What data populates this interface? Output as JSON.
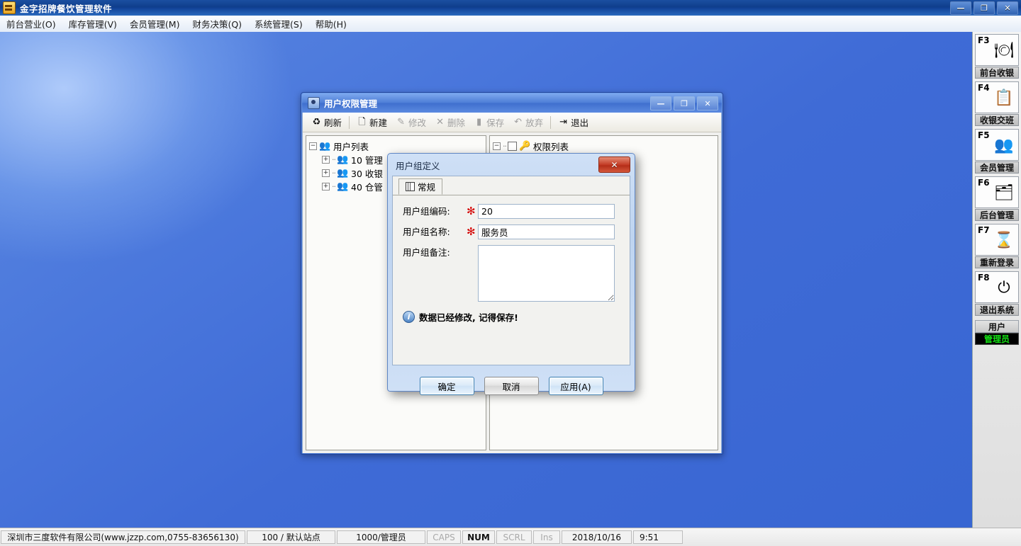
{
  "window": {
    "title": "金字招牌餐饮管理软件",
    "icon": "app-icon",
    "controls": {
      "minimize": "—",
      "restore": "❐",
      "close": "✕"
    }
  },
  "menubar": {
    "items": [
      {
        "label": "前台营业(O)"
      },
      {
        "label": "库存管理(V)"
      },
      {
        "label": "会员管理(M)"
      },
      {
        "label": "财务决策(Q)"
      },
      {
        "label": "系统管理(S)"
      },
      {
        "label": "帮助(H)"
      }
    ]
  },
  "sidebar": {
    "items": [
      {
        "key": "F3",
        "icon": "table-chairs-icon",
        "glyph": "🍽",
        "caption": "前台收银"
      },
      {
        "key": "F4",
        "icon": "clipboard-check-icon",
        "glyph": "📋",
        "caption": "收银交班"
      },
      {
        "key": "F5",
        "icon": "members-icon",
        "glyph": "👥",
        "caption": "会员管理"
      },
      {
        "key": "F6",
        "icon": "folder-tools-icon",
        "glyph": "🗂",
        "caption": "后台管理"
      },
      {
        "key": "F7",
        "icon": "hourglass-icon",
        "glyph": "⌛",
        "caption": "重新登录"
      },
      {
        "key": "F8",
        "icon": "power-icon",
        "glyph": "⏻",
        "caption": "退出系统"
      }
    ],
    "user_box": {
      "title": "用户",
      "name": "管理员"
    }
  },
  "child_window": {
    "title": "用户权限管理",
    "icon": "user-permission-icon",
    "controls": {
      "minimize": "—",
      "restore": "❐",
      "close": "✕"
    },
    "toolbar": [
      {
        "label": "刷新",
        "icon": "refresh-icon",
        "glyph": "♻",
        "disabled": false
      },
      {
        "label": "新建",
        "icon": "new-document-icon",
        "glyph": "🗋",
        "disabled": false
      },
      {
        "label": "修改",
        "icon": "edit-icon",
        "glyph": "✎",
        "disabled": true
      },
      {
        "label": "删除",
        "icon": "delete-icon",
        "glyph": "✕",
        "disabled": true
      },
      {
        "label": "保存",
        "icon": "save-icon",
        "glyph": "▮",
        "disabled": true
      },
      {
        "label": "放弃",
        "icon": "undo-icon",
        "glyph": "↶",
        "disabled": true
      },
      {
        "label": "退出",
        "icon": "exit-icon",
        "glyph": "⇥",
        "disabled": false
      }
    ],
    "left_pane": {
      "root": {
        "label": "用户列表",
        "expander": "−",
        "icon": "user-group-icon"
      },
      "children": [
        {
          "label": "10 管理",
          "expander": "+",
          "icon": "user-group-icon"
        },
        {
          "label": "30 收银",
          "expander": "+",
          "icon": "user-group-icon"
        },
        {
          "label": "40 仓管",
          "expander": "+",
          "icon": "user-group-icon"
        }
      ]
    },
    "right_pane": {
      "root": {
        "label": "权限列表",
        "expander": "−",
        "icon": "permission-icon"
      }
    }
  },
  "dialog": {
    "title": "用户组定义",
    "close_label": "✕",
    "tab": {
      "label": "常规",
      "icon": "grid-icon"
    },
    "fields": {
      "code": {
        "label": "用户组编码:",
        "required": "✻",
        "value": "20",
        "placeholder": ""
      },
      "name": {
        "label": "用户组名称:",
        "required": "✻",
        "value": "服务员",
        "placeholder": ""
      },
      "remark": {
        "label": "用户组备注:",
        "value": "",
        "placeholder": ""
      }
    },
    "info": {
      "icon": "info-icon",
      "glyph": "i",
      "text": "数据已经修改, 记得保存!"
    },
    "buttons": {
      "ok": "确定",
      "cancel": "取消",
      "apply": "应用(A)"
    }
  },
  "statusbar": {
    "company": "深圳市三度软件有限公司(www.jzzp.com,0755-83656130)",
    "station": "100 / 默认站点",
    "operator": "1000/管理员",
    "caps": "CAPS",
    "num": "NUM",
    "scrl": "SCRL",
    "ins": "Ins",
    "date": "2018/10/16",
    "time": "9:51"
  },
  "colors": {
    "desktop_blue": "#3f6bd6",
    "title_blue": "#13459a",
    "close_red": "#c0351f",
    "user_green": "#14e014",
    "required_red": "#d40000"
  }
}
